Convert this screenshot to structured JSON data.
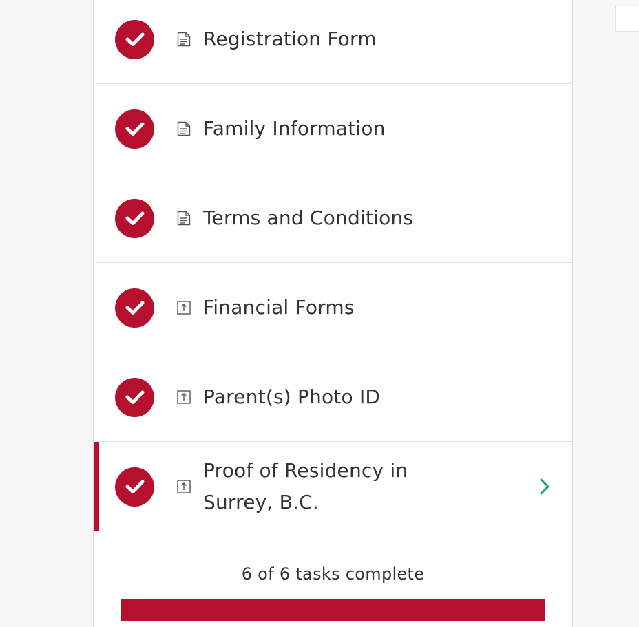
{
  "colors": {
    "accent": "#b5112f",
    "chevron": "#1fa35e",
    "text": "#333333"
  },
  "tasks": [
    {
      "label": "Registration Form",
      "status": "complete",
      "type_icon": "document-icon"
    },
    {
      "label": "Family Information",
      "status": "complete",
      "type_icon": "document-icon"
    },
    {
      "label": "Terms and Conditions",
      "status": "complete",
      "type_icon": "document-icon"
    },
    {
      "label": "Financial Forms",
      "status": "complete",
      "type_icon": "upload-icon"
    },
    {
      "label": "Parent(s) Photo ID",
      "status": "complete",
      "type_icon": "upload-icon"
    },
    {
      "label": "Proof of Residency in Surrey, B.C.",
      "status": "complete",
      "type_icon": "upload-icon",
      "selected": true
    }
  ],
  "progress": {
    "text": "6 of 6 tasks complete",
    "completed": 6,
    "total": 6,
    "fraction": 1.0
  }
}
